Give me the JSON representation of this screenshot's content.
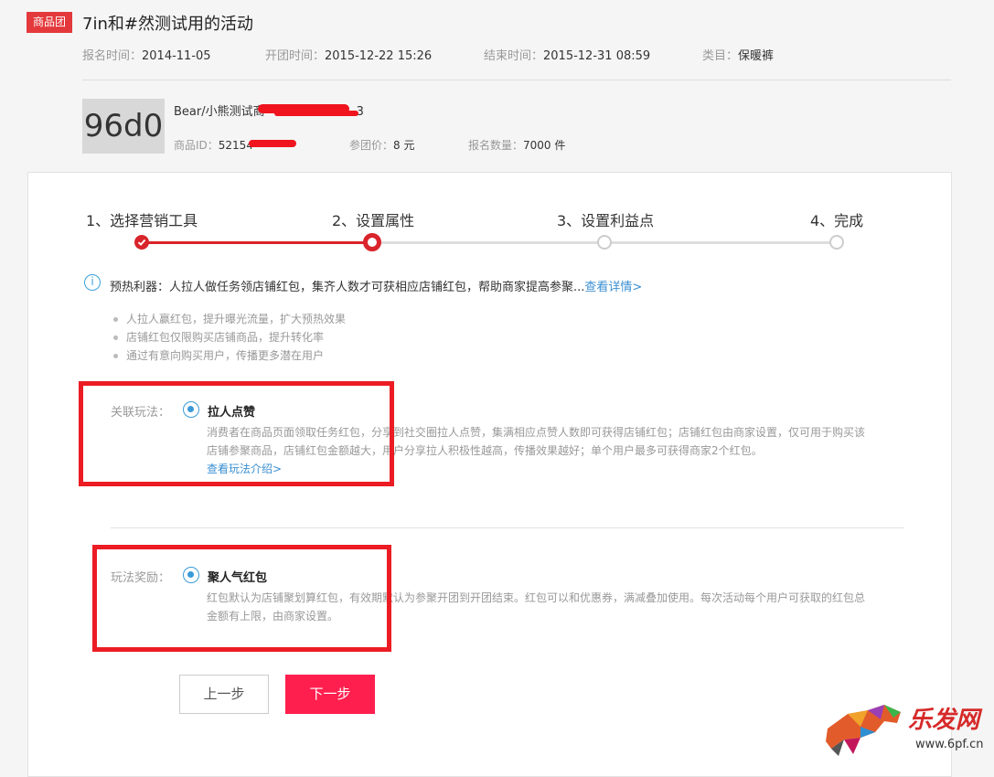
{
  "header": {
    "badge": "商品团",
    "title": "7in和#然测试用的活动",
    "meta": [
      {
        "label": "报名时间：",
        "value": "2014-11-05"
      },
      {
        "label": "开团时间：",
        "value": "2015-12-22 15:26"
      },
      {
        "label": "结束时间：",
        "value": "2015-12-31 08:59"
      },
      {
        "label": "类目：",
        "value": "保暖裤"
      }
    ]
  },
  "product": {
    "thumb_text": "96d0",
    "name": "Bear/小熊测试商",
    "name_suffix": "3",
    "id_label": "商品ID：",
    "id_value": "52154",
    "price_label": "参团价：",
    "price_value": "8 元",
    "qty_label": "报名数量：",
    "qty_value": "7000 件"
  },
  "steps": [
    "1、选择营销工具",
    "2、设置属性",
    "3、设置利益点",
    "4、完成"
  ],
  "colors": {
    "accent": "#e4393c",
    "link": "#3a8fd2",
    "radio": "#3a9ad8",
    "next_button": "#ff1f4e",
    "annotation": "#ec1c24"
  },
  "info": {
    "text": "预热利器：人拉人做任务领店铺红包，集齐人数才可获相应店铺红包，帮助商家提高参聚...",
    "link": "查看详情>",
    "bullets": [
      "人拉人赢红包，提升曝光流量，扩大预热效果",
      "店铺红包仅限购买店铺商品，提升转化率",
      "通过有意向购买用户，传播更多潜在用户"
    ]
  },
  "option1": {
    "label": "关联玩法：",
    "title": "拉人点赞",
    "desc1": "消费者在商品页面领取任务红包，分享到社交圈拉人点赞，集满相应点赞人数即可获得店铺红包；店铺红包由商家设置，仅可用于购买该",
    "desc2": "店铺参聚商品，店铺红包金额越大，用户分享拉人积极性越高，传播效果越好；单个用户最多可获得商家2个红包。",
    "link": "查看玩法介绍>"
  },
  "option2": {
    "label": "玩法奖励：",
    "title": "聚人气红包",
    "desc1": "红包默认为店铺聚划算红包，有效期默认为参聚开团到开团结束。红包可以和优惠券，满减叠加使用。每次活动每个用户可获取的红包总",
    "desc2": "金额有上限，由商家设置。"
  },
  "buttons": {
    "prev": "上一步",
    "next": "下一步"
  },
  "watermark": {
    "text": "乐发网",
    "url": "www.6pf.cn"
  }
}
